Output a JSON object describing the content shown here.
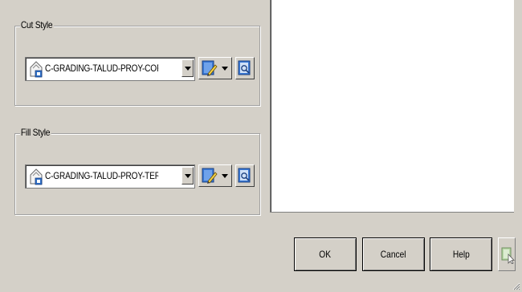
{
  "cut_style": {
    "legend": "Cut Style",
    "selected_value": "C-GRADING-TALUD-PROY-CORTE"
  },
  "fill_style": {
    "legend": "Fill Style",
    "selected_value": "C-GRADING-TALUD-PROY-TERRAPLEN"
  },
  "buttons": {
    "ok_label": "OK",
    "cancel_label": "Cancel",
    "help_label": "Help"
  },
  "icons": {
    "style_icon": "style-document-icon",
    "edit_icon": "edit-style-icon",
    "details_icon": "style-details-icon",
    "pick_icon": "pick-from-drawing-icon"
  },
  "colors": {
    "dialog_bg": "#d4d0c8",
    "preview_bg": "#ffffff",
    "icon_blue": "#2f6fc7"
  }
}
